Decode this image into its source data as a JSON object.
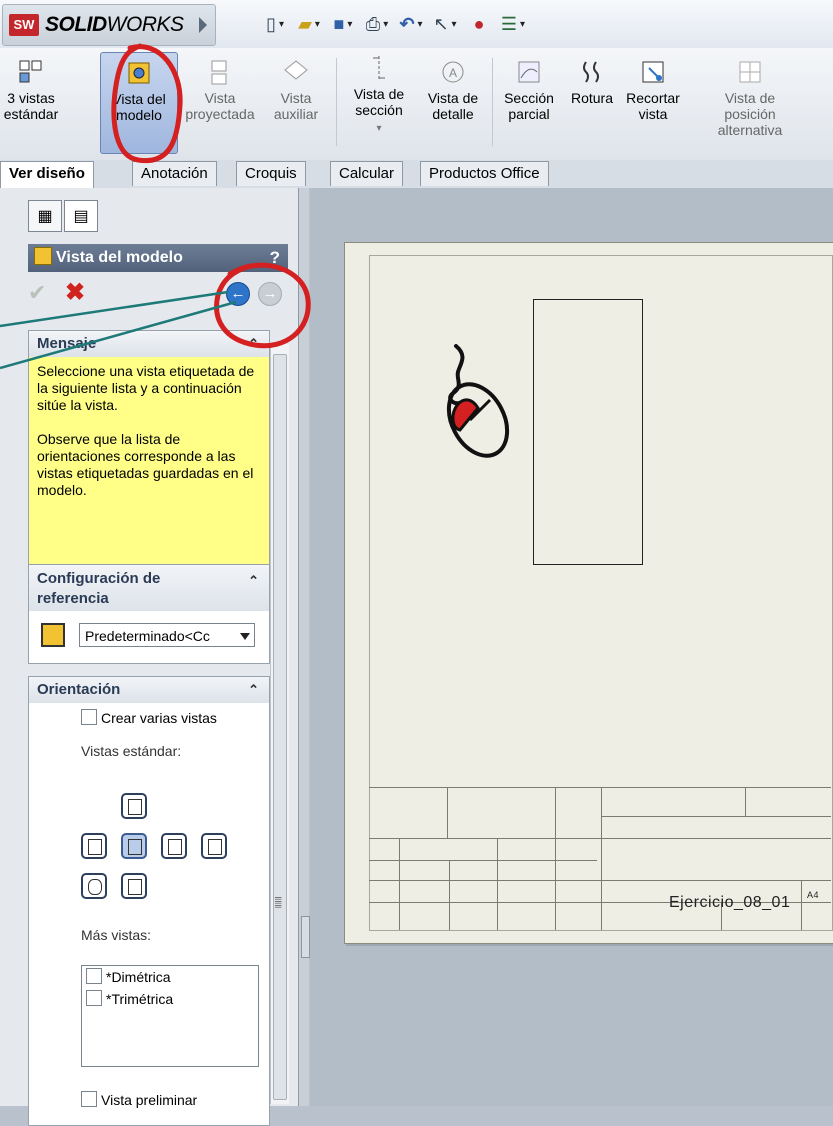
{
  "app": {
    "logo_badge": "SW",
    "logo_bold": "SOLID",
    "logo_light": "WORKS"
  },
  "ribbon": {
    "buttons": [
      {
        "line1": "3 vistas",
        "line2": "estándar"
      },
      {
        "line1": "Vista del",
        "line2": "modelo"
      },
      {
        "line1": "Vista",
        "line2": "proyectada"
      },
      {
        "line1": "Vista",
        "line2": "auxiliar"
      },
      {
        "line1": "Vista de",
        "line2": "sección"
      },
      {
        "line1": "Vista de",
        "line2": "detalle"
      },
      {
        "line1": "Sección",
        "line2": "parcial"
      },
      {
        "line1": "Rotura",
        "line2": ""
      },
      {
        "line1": "Recortar",
        "line2": "vista"
      },
      {
        "line1": "Vista de",
        "line2": "posición",
        "line3": "alternativa"
      }
    ]
  },
  "tabs": [
    "Ver diseño",
    "Anotación",
    "Croquis",
    "Calcular",
    "Productos Office"
  ],
  "panel": {
    "title": "Vista del modelo",
    "help": "?",
    "message": {
      "header": "Mensaje",
      "p1": "Seleccione una vista etiquetada de la siguiente lista y a continuación sitúe la vista.",
      "p2": "Observe que la lista de orientaciones corresponde a las vistas etiquetadas guardadas en el modelo."
    },
    "config": {
      "header_line1": "Configuración de",
      "header_line2": "referencia",
      "selected": "Predeterminado<Cc"
    },
    "orientation": {
      "header": "Orientación",
      "multi_label": "Crear varias vistas",
      "standard_label": "Vistas estándar:",
      "more_label": "Más vistas:",
      "more_items": [
        "*Dimétrica",
        "*Trimétrica"
      ],
      "preview_label": "Vista preliminar"
    }
  },
  "drawing": {
    "sheet_name": "Ejercicio_08_01",
    "sheet_size": "A4"
  },
  "colors": {
    "annotation_red": "#d42020",
    "annotation_teal": "#1d7a78",
    "message_bg": "#ffff88"
  }
}
